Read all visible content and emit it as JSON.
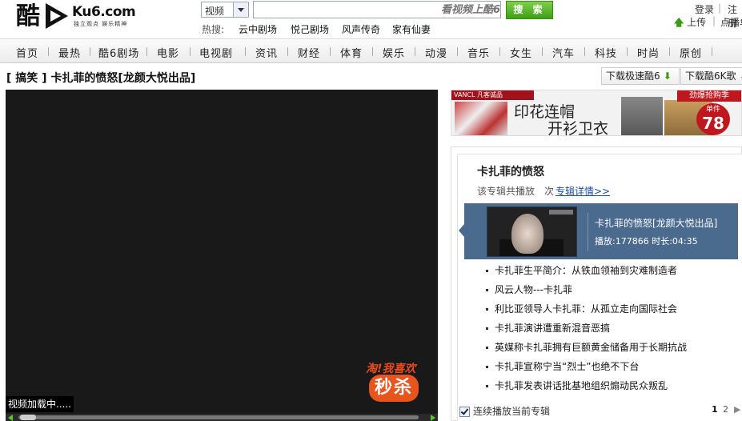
{
  "header": {
    "logo_char": "酷",
    "logo_brand": "Ku6.com",
    "logo_slogan": "独立观点 娱乐精神",
    "search_category": "视频",
    "search_placeholder": "看视频上酷6",
    "search_button": "搜 索",
    "hot_label": "热搜:",
    "hot_items": [
      "云中剧场",
      "悦己剧场",
      "风声传奇",
      "家有仙妻"
    ],
    "login": "登录",
    "register": "注册",
    "upload": "上传",
    "dianbo": "点播单"
  },
  "nav": {
    "items": [
      "首页",
      "最热",
      "酷6剧场",
      "电影",
      "电视剧",
      "资讯",
      "财经",
      "体育",
      "娱乐",
      "动漫",
      "音乐",
      "女生",
      "汽车",
      "科技",
      "时尚",
      "原创"
    ]
  },
  "video": {
    "title": "[ 搞笑 ] 卡扎菲的愤怒[龙颜大悦出品]",
    "download_fast": "下载极速酷6",
    "download_song": "下载酷6K歌",
    "loading_text": "视频加载中.....",
    "promo_line1": "淘!我喜欢",
    "promo_line2": "秒杀"
  },
  "ad": {
    "brand": "VANCL 凡客诚品",
    "headline1": "印花连帽",
    "headline2": "开衫卫衣",
    "tag": "劲爆抢购季",
    "badge_label": "单件",
    "badge_price": "78"
  },
  "album": {
    "title": "卡扎菲的愤怒",
    "meta": "该专辑共播放　次",
    "detail_link": "专辑详情>>",
    "current": {
      "title": "卡扎菲的愤怒[龙颜大悦出品]",
      "stats": "播放:177866 时长:04:35"
    },
    "items": [
      "卡扎菲生平简介：从铁血领袖到灾难制造者",
      "风云人物---卡扎菲",
      "利比亚领导人卡扎菲：从孤立走向国际社会",
      "卡扎菲演讲遭重新混音恶搞",
      "英媒称卡扎菲拥有巨额黄金储备用于长期抗战",
      "卡扎菲宣称宁当“烈士”也绝不下台",
      "卡扎菲发表讲话批基地组织煽动民众叛乱"
    ],
    "autoplay_label": "连续播放当前专辑",
    "page_current": "1",
    "page_next": "2"
  },
  "colors": {
    "accent_green": "#3e9e16",
    "album_highlight": "#4a6a8e",
    "player_bg": "#191919"
  }
}
